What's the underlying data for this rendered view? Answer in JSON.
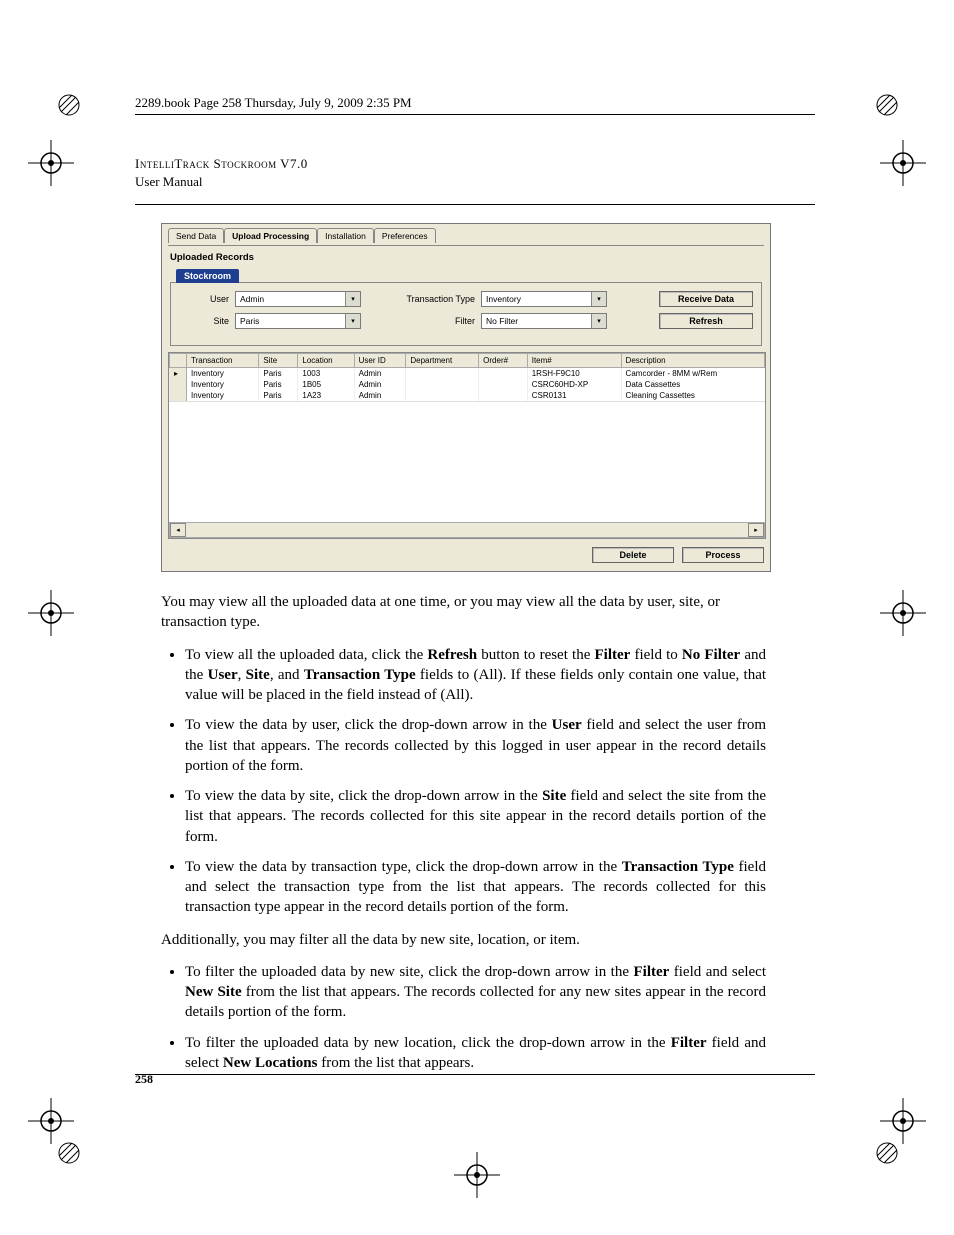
{
  "bookline": "2289.book  Page 258  Thursday, July 9, 2009  2:35 PM",
  "header": {
    "line1": "IntelliTrack Stockroom V7.0",
    "line2": "User Manual"
  },
  "app": {
    "tabs": [
      "Send Data",
      "Upload Processing",
      "Installation",
      "Preferences"
    ],
    "active_tab": 1,
    "section_title": "Uploaded Records",
    "subtab": "Stockroom",
    "filters": {
      "user_label": "User",
      "user_value": "Admin",
      "site_label": "Site",
      "site_value": "Paris",
      "ttype_label": "Transaction Type",
      "ttype_value": "Inventory",
      "filter_label": "Filter",
      "filter_value": "No Filter"
    },
    "buttons": {
      "receive": "Receive Data",
      "refresh": "Refresh",
      "delete": "Delete",
      "process": "Process"
    },
    "columns": [
      "Transaction",
      "Site",
      "Location",
      "User ID",
      "Department",
      "Order#",
      "Item#",
      "Description"
    ],
    "rows": [
      {
        "Transaction": "Inventory",
        "Site": "Paris",
        "Location": "1003",
        "UserID": "Admin",
        "Department": "",
        "Order": "",
        "Item": "1RSH-F9C10",
        "Description": "Camcorder - 8MM w/Rem"
      },
      {
        "Transaction": "Inventory",
        "Site": "Paris",
        "Location": "1B05",
        "UserID": "Admin",
        "Department": "",
        "Order": "",
        "Item": "CSRC60HD-XP",
        "Description": "Data Cassettes"
      },
      {
        "Transaction": "Inventory",
        "Site": "Paris",
        "Location": "1A23",
        "UserID": "Admin",
        "Department": "",
        "Order": "",
        "Item": "CSR0131",
        "Description": "Cleaning Cassettes"
      }
    ]
  },
  "body": {
    "p1": "You may view all the uploaded data at one time, or you may view all the data by user, site, or transaction type.",
    "li1_a": "To view all the uploaded data, click the ",
    "li1_b": "Refresh",
    "li1_c": " button to reset the ",
    "li1_d": "Filter",
    "li1_e": " field to ",
    "li1_f": "No Filter",
    "li1_g": " and the ",
    "li1_h": "User",
    "li1_i": ", ",
    "li1_j": "Site",
    "li1_k": ", and ",
    "li1_l": "Transaction Type",
    "li1_m": " fields to (All). If these fields only contain one value, that value will be placed in the field instead of (All).",
    "li2_a": "To view the data by user, click the drop-down arrow in the ",
    "li2_b": "User",
    "li2_c": " field and select the user from the list that appears. The records collected by this logged in user appear in the record details portion of the form.",
    "li3_a": "To view the data by site, click the drop-down arrow in the ",
    "li3_b": "Site",
    "li3_c": " field and select the site from the list that appears. The records collected for this site appear in the record details portion of the form.",
    "li4_a": "To view the data by transaction type, click the drop-down arrow in the ",
    "li4_b": "Transaction Type",
    "li4_c": " field and select the transaction type from the list that appears. The records collected for this transaction type appear in the record details portion of the form.",
    "p2": "Additionally, you may filter all the data by new site, location, or item.",
    "li5_a": "To filter the uploaded data by new site, click the drop-down arrow in the ",
    "li5_b": "Filter",
    "li5_c": " field and select ",
    "li5_d": "New Site",
    "li5_e": " from the list that appears. The records collected for any new sites appear in the record details portion of the form.",
    "li6_a": "To filter the uploaded data by new location, click the drop-down arrow in the ",
    "li6_b": "Filter",
    "li6_c": " field and select ",
    "li6_d": "New Locations",
    "li6_e": " from the list that appears."
  },
  "pagenum": "258"
}
